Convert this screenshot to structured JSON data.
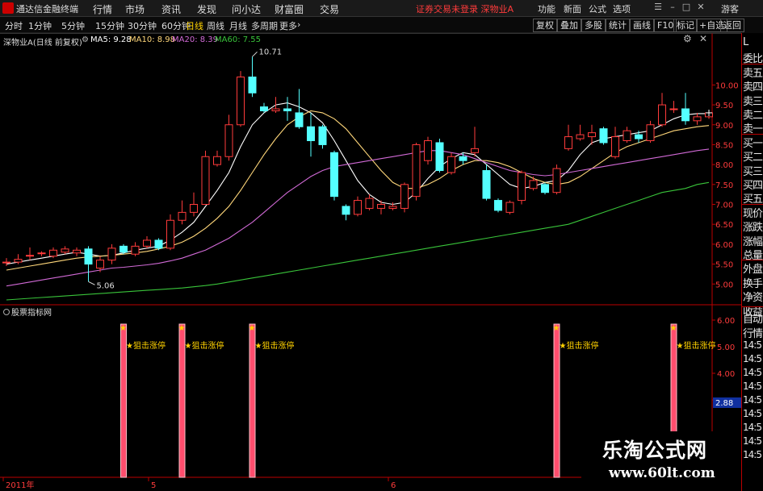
{
  "titlebar": {
    "app_name": "通达信金融终端",
    "menus": [
      "行情",
      "市场",
      "资讯",
      "发现",
      "问小达",
      "财富圈",
      "交易"
    ],
    "status": "证券交易未登录  深物业A",
    "right_menus": [
      "功能",
      "新面",
      "公式",
      "选项",
      "游客"
    ]
  },
  "toolbar": {
    "timeframes": [
      "分时",
      "1分钟",
      "5分钟",
      "15分钟",
      "30分钟",
      "60分钟",
      "日线",
      "周线",
      "月线",
      "多周期",
      "更多"
    ],
    "active_timeframe": "日线",
    "right_buttons": [
      "复权",
      "叠加",
      "多股",
      "统计",
      "画线",
      "F10",
      "标记",
      "+自选",
      "返回"
    ]
  },
  "chart_header": {
    "stock_label": "深物业A(日线 前复权)",
    "ma5": "MA5: 9.28",
    "ma10": "MA10: 8.98",
    "ma20": "MA20: 8.39",
    "ma60": "MA60: 7.55"
  },
  "indicator": {
    "panel_label": "股票指标网",
    "signal_text": "狙击涨停",
    "y_ticks": [
      "6.00",
      "5.00",
      "4.00",
      "3.00"
    ],
    "highlight_value": "2.88"
  },
  "side_panel": {
    "labels": [
      "L",
      "委比",
      "卖五",
      "卖四",
      "卖三",
      "卖二",
      "卖一",
      "买一",
      "买二",
      "买三",
      "买四",
      "买五",
      "现价",
      "涨跌",
      "涨幅",
      "总量",
      "外盘",
      "换手",
      "净资",
      "收益"
    ],
    "lower": [
      "自动",
      "行情",
      "14:5",
      "14:5",
      "14:5",
      "14:5",
      "14:5",
      "14:5",
      "14:5",
      "14:5",
      "14:5"
    ]
  },
  "xaxis": {
    "labels": [
      "2011年",
      "5",
      "6"
    ]
  },
  "watermark": {
    "title": "乐淘公式网",
    "url": "www.60lt.com"
  },
  "chart_data": {
    "type": "candlestick",
    "yticks": [
      10.0,
      9.5,
      9.0,
      8.5,
      8.0,
      7.5,
      7.0,
      6.5,
      6.0,
      5.5,
      5.0
    ],
    "ylim": [
      4.6,
      11.0
    ],
    "annotations": [
      {
        "label": "10.71",
        "value": 10.71
      },
      {
        "label": "5.06",
        "value": 5.06
      }
    ],
    "candles": [
      {
        "o": 5.55,
        "c": 5.55,
        "h": 5.65,
        "l": 5.45
      },
      {
        "o": 5.55,
        "c": 5.62,
        "h": 5.75,
        "l": 5.5
      },
      {
        "o": 5.7,
        "c": 5.72,
        "h": 5.92,
        "l": 5.6
      },
      {
        "o": 5.78,
        "c": 5.78,
        "h": 5.82,
        "l": 5.7
      },
      {
        "o": 5.7,
        "c": 5.85,
        "h": 5.92,
        "l": 5.65
      },
      {
        "o": 5.8,
        "c": 5.88,
        "h": 5.95,
        "l": 5.75
      },
      {
        "o": 5.78,
        "c": 5.85,
        "h": 5.92,
        "l": 5.7
      },
      {
        "o": 5.88,
        "c": 5.5,
        "h": 5.95,
        "l": 5.06
      },
      {
        "o": 5.4,
        "c": 5.6,
        "h": 5.7,
        "l": 5.3
      },
      {
        "o": 5.6,
        "c": 5.9,
        "h": 6.0,
        "l": 5.5
      },
      {
        "o": 5.95,
        "c": 5.8,
        "h": 6.0,
        "l": 5.75
      },
      {
        "o": 5.75,
        "c": 5.95,
        "h": 6.05,
        "l": 5.7
      },
      {
        "o": 5.95,
        "c": 6.1,
        "h": 6.2,
        "l": 5.9
      },
      {
        "o": 6.1,
        "c": 5.9,
        "h": 6.15,
        "l": 5.85
      },
      {
        "o": 5.9,
        "c": 6.6,
        "h": 6.75,
        "l": 5.85
      },
      {
        "o": 6.6,
        "c": 6.8,
        "h": 7.1,
        "l": 6.5
      },
      {
        "o": 6.8,
        "c": 7.0,
        "h": 7.3,
        "l": 6.7
      },
      {
        "o": 7.0,
        "c": 8.2,
        "h": 8.35,
        "l": 7.0
      },
      {
        "o": 8.0,
        "c": 8.2,
        "h": 8.35,
        "l": 7.95
      },
      {
        "o": 8.2,
        "c": 9.0,
        "h": 9.25,
        "l": 8.1
      },
      {
        "o": 9.0,
        "c": 10.2,
        "h": 10.35,
        "l": 8.95
      },
      {
        "o": 10.2,
        "c": 9.8,
        "h": 10.71,
        "l": 9.7
      },
      {
        "o": 9.45,
        "c": 9.35,
        "h": 9.55,
        "l": 9.3
      },
      {
        "o": 9.35,
        "c": 9.4,
        "h": 9.7,
        "l": 9.3
      },
      {
        "o": 9.4,
        "c": 9.35,
        "h": 9.7,
        "l": 9.1
      },
      {
        "o": 9.3,
        "c": 8.95,
        "h": 9.9,
        "l": 8.9
      },
      {
        "o": 8.95,
        "c": 8.6,
        "h": 9.3,
        "l": 8.2
      },
      {
        "o": 8.95,
        "c": 8.5,
        "h": 9.0,
        "l": 8.4
      },
      {
        "o": 8.3,
        "c": 7.2,
        "h": 8.35,
        "l": 7.1
      },
      {
        "o": 6.95,
        "c": 6.75,
        "h": 7.0,
        "l": 6.6
      },
      {
        "o": 6.75,
        "c": 7.1,
        "h": 7.2,
        "l": 6.7
      },
      {
        "o": 6.9,
        "c": 7.15,
        "h": 7.25,
        "l": 6.85
      },
      {
        "o": 6.9,
        "c": 7.0,
        "h": 7.1,
        "l": 6.75
      },
      {
        "o": 6.9,
        "c": 6.95,
        "h": 7.05,
        "l": 6.85
      },
      {
        "o": 6.9,
        "c": 7.5,
        "h": 7.55,
        "l": 6.8
      },
      {
        "o": 7.2,
        "c": 8.5,
        "h": 8.55,
        "l": 7.1
      },
      {
        "o": 8.1,
        "c": 8.6,
        "h": 8.7,
        "l": 8.0
      },
      {
        "o": 8.55,
        "c": 7.85,
        "h": 8.65,
        "l": 7.8
      },
      {
        "o": 7.8,
        "c": 8.2,
        "h": 8.3,
        "l": 7.75
      },
      {
        "o": 8.2,
        "c": 8.1,
        "h": 8.3,
        "l": 8.0
      },
      {
        "o": 8.3,
        "c": 8.4,
        "h": 8.95,
        "l": 8.2
      },
      {
        "o": 7.85,
        "c": 7.15,
        "h": 8.0,
        "l": 7.1
      },
      {
        "o": 7.1,
        "c": 6.85,
        "h": 7.15,
        "l": 6.8
      },
      {
        "o": 6.8,
        "c": 7.05,
        "h": 7.1,
        "l": 6.75
      },
      {
        "o": 7.1,
        "c": 7.8,
        "h": 7.85,
        "l": 7.0
      },
      {
        "o": 7.4,
        "c": 7.6,
        "h": 7.7,
        "l": 7.35
      },
      {
        "o": 7.5,
        "c": 7.3,
        "h": 7.55,
        "l": 7.25
      },
      {
        "o": 7.3,
        "c": 7.9,
        "h": 8.0,
        "l": 7.25
      },
      {
        "o": 8.4,
        "c": 8.7,
        "h": 9.0,
        "l": 8.35
      },
      {
        "o": 8.65,
        "c": 8.75,
        "h": 9.0,
        "l": 8.6
      },
      {
        "o": 8.7,
        "c": 8.8,
        "h": 9.0,
        "l": 8.5
      },
      {
        "o": 8.9,
        "c": 8.55,
        "h": 8.95,
        "l": 8.5
      },
      {
        "o": 8.2,
        "c": 8.7,
        "h": 8.95,
        "l": 8.15
      },
      {
        "o": 8.6,
        "c": 8.85,
        "h": 8.95,
        "l": 8.55
      },
      {
        "o": 8.75,
        "c": 8.65,
        "h": 8.85,
        "l": 8.55
      },
      {
        "o": 8.6,
        "c": 9.0,
        "h": 9.1,
        "l": 8.55
      },
      {
        "o": 9.0,
        "c": 9.5,
        "h": 9.8,
        "l": 8.95
      },
      {
        "o": 9.4,
        "c": 9.4,
        "h": 9.6,
        "l": 9.3
      },
      {
        "o": 9.4,
        "c": 9.1,
        "h": 9.8,
        "l": 9.0
      },
      {
        "o": 9.1,
        "c": 9.2,
        "h": 9.3,
        "l": 9.0
      },
      {
        "o": 9.2,
        "c": 9.3,
        "h": 9.35,
        "l": 9.15
      }
    ],
    "series": [
      {
        "name": "MA5",
        "color": "#ffffff",
        "values": [
          5.5,
          5.55,
          5.6,
          5.65,
          5.7,
          5.75,
          5.8,
          5.75,
          5.7,
          5.72,
          5.78,
          5.85,
          5.9,
          5.95,
          6.1,
          6.3,
          6.55,
          6.95,
          7.35,
          7.8,
          8.45,
          9.0,
          9.3,
          9.5,
          9.55,
          9.45,
          9.3,
          9.05,
          8.6,
          8.1,
          7.6,
          7.25,
          7.05,
          7.0,
          7.05,
          7.3,
          7.65,
          7.95,
          8.15,
          8.3,
          8.25,
          8.0,
          7.75,
          7.5,
          7.4,
          7.45,
          7.55,
          7.6,
          7.85,
          8.25,
          8.55,
          8.65,
          8.7,
          8.75,
          8.8,
          8.85,
          9.0,
          9.15,
          9.25,
          9.28,
          9.28
        ]
      },
      {
        "name": "MA10",
        "color": "#ffd77a",
        "values": [
          5.35,
          5.4,
          5.45,
          5.5,
          5.55,
          5.6,
          5.65,
          5.68,
          5.7,
          5.72,
          5.75,
          5.78,
          5.82,
          5.88,
          5.95,
          6.05,
          6.2,
          6.4,
          6.65,
          6.95,
          7.35,
          7.8,
          8.25,
          8.65,
          9.0,
          9.2,
          9.35,
          9.3,
          9.15,
          8.9,
          8.55,
          8.2,
          7.85,
          7.55,
          7.4,
          7.4,
          7.5,
          7.65,
          7.85,
          8.0,
          8.1,
          8.1,
          8.05,
          7.95,
          7.8,
          7.65,
          7.55,
          7.5,
          7.55,
          7.7,
          7.9,
          8.1,
          8.3,
          8.45,
          8.55,
          8.65,
          8.75,
          8.85,
          8.9,
          8.95,
          8.98
        ]
      },
      {
        "name": "MA20",
        "color": "#d16ad6",
        "values": [
          4.95,
          5.0,
          5.05,
          5.1,
          5.15,
          5.2,
          5.25,
          5.3,
          5.35,
          5.4,
          5.42,
          5.45,
          5.48,
          5.52,
          5.58,
          5.65,
          5.75,
          5.85,
          6.0,
          6.15,
          6.35,
          6.55,
          6.8,
          7.05,
          7.3,
          7.5,
          7.7,
          7.85,
          7.95,
          8.0,
          8.05,
          8.1,
          8.15,
          8.2,
          8.25,
          8.3,
          8.35,
          8.35,
          8.3,
          8.25,
          8.15,
          8.05,
          7.95,
          7.85,
          7.8,
          7.75,
          7.72,
          7.75,
          7.8,
          7.85,
          7.9,
          7.95,
          8.0,
          8.05,
          8.1,
          8.15,
          8.2,
          8.25,
          8.3,
          8.35,
          8.39
        ]
      },
      {
        "name": "MA60",
        "color": "#39c43a",
        "values": [
          4.6,
          4.62,
          4.64,
          4.66,
          4.68,
          4.7,
          4.72,
          4.74,
          4.76,
          4.78,
          4.8,
          4.82,
          4.84,
          4.86,
          4.88,
          4.9,
          4.93,
          4.96,
          5.0,
          5.05,
          5.1,
          5.15,
          5.2,
          5.25,
          5.3,
          5.35,
          5.4,
          5.45,
          5.5,
          5.55,
          5.6,
          5.65,
          5.7,
          5.75,
          5.8,
          5.85,
          5.9,
          5.95,
          6.0,
          6.05,
          6.1,
          6.15,
          6.2,
          6.25,
          6.3,
          6.35,
          6.4,
          6.45,
          6.5,
          6.6,
          6.7,
          6.8,
          6.9,
          7.0,
          7.1,
          7.2,
          7.3,
          7.35,
          7.4,
          7.5,
          7.55
        ]
      }
    ],
    "signal_indices": [
      10,
      15,
      21,
      47,
      57
    ]
  }
}
